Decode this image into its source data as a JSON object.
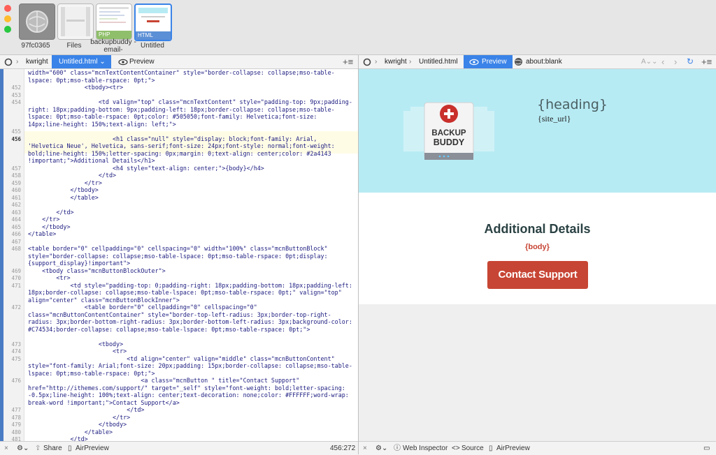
{
  "shelf": {
    "docs": [
      {
        "label": "97fc0365"
      },
      {
        "label": "Files"
      },
      {
        "label": "backupbuddy -email-",
        "tag": "PHP"
      },
      {
        "label": "Untitled",
        "tag": "HTML"
      }
    ]
  },
  "left_bar": {
    "user": "kwright",
    "tab": "Untitled.html",
    "preview_label": "Preview"
  },
  "right_bar": {
    "user": "kwright",
    "file": "Untitled.html",
    "preview_label": "Preview",
    "url": "about:blank"
  },
  "editor": {
    "lines": [
      {
        "n": "",
        "t": "width=\"600\" class=\"mcnTextContentContainer\" style=\"border-collapse: collapse;mso-table-lspace: 0pt;mso-table-rspace: 0pt;\">"
      },
      {
        "n": "452",
        "t": "                <tbody><tr>"
      },
      {
        "n": "453",
        "t": ""
      },
      {
        "n": "454",
        "t": "                    <td valign=\"top\" class=\"mcnTextContent\" style=\"padding-top: 9px;padding-right: 18px;padding-bottom: 9px;padding-left: 18px;border-collapse: collapse;mso-table-lspace: 0pt;mso-table-rspace: 0pt;color: #505050;font-family: Helvetica;font-size: 14px;line-height: 150%;text-align: left;\">"
      },
      {
        "n": "455",
        "t": ""
      },
      {
        "n": "456",
        "t": "                        <h1 class=\"null\" style=\"display: block;font-family: Arial, 'Helvetica Neue', Helvetica, sans-serif;font-size: 24px;font-style: normal;font-weight: bold;line-height: 150%;letter-spacing: 0px;margin: 0;text-align: center;color: #2a4143 !important;\">Additional Details</h1>"
      },
      {
        "n": "457",
        "t": "                        <h4 style=\"text-align: center;\">{body}</h4>"
      },
      {
        "n": "458",
        "t": "                    </td>"
      },
      {
        "n": "459",
        "t": "                </tr>"
      },
      {
        "n": "460",
        "t": "            </tbody>"
      },
      {
        "n": "461",
        "t": "            </table>"
      },
      {
        "n": "462",
        "t": ""
      },
      {
        "n": "463",
        "t": "        </td>"
      },
      {
        "n": "464",
        "t": "    </tr>"
      },
      {
        "n": "465",
        "t": "    </tbody>"
      },
      {
        "n": "466",
        "t": "</table>"
      },
      {
        "n": "467",
        "t": ""
      },
      {
        "n": "468",
        "t": "<table border=\"0\" cellpadding=\"0\" cellspacing=\"0\" width=\"100%\" class=\"mcnButtonBlock\" style=\"border-collapse: collapse;mso-table-lspace: 0pt;mso-table-rspace: 0pt;display: {support_display}!important\">"
      },
      {
        "n": "469",
        "t": "    <tbody class=\"mcnButtonBlockOuter\">"
      },
      {
        "n": "470",
        "t": "        <tr>"
      },
      {
        "n": "471",
        "t": "            <td style=\"padding-top: 0;padding-right: 18px;padding-bottom: 18px;padding-left: 18px;border-collapse: collapse;mso-table-lspace: 0pt;mso-table-rspace: 0pt;\" valign=\"top\" align=\"center\" class=\"mcnButtonBlockInner\">"
      },
      {
        "n": "472",
        "t": "                <table border=\"0\" cellpadding=\"0\" cellspacing=\"0\" class=\"mcnButtonContentContainer\" style=\"border-top-left-radius: 3px;border-top-right-radius: 3px;border-bottom-right-radius: 3px;border-bottom-left-radius: 3px;background-color: #C74534;border-collapse: collapse;mso-table-lspace: 0pt;mso-table-rspace: 0pt;\">"
      },
      {
        "n": "473",
        "t": "                    <tbody>"
      },
      {
        "n": "474",
        "t": "                        <tr>"
      },
      {
        "n": "475",
        "t": "                            <td align=\"center\" valign=\"middle\" class=\"mcnButtonContent\" style=\"font-family: Arial;font-size: 20px;padding: 15px;border-collapse: collapse;mso-table-lspace: 0pt;mso-table-rspace: 0pt;\">"
      },
      {
        "n": "476",
        "t": "                                <a class=\"mcnButton \" title=\"Contact Support\" href=\"http://ithemes.com/support/\" target=\"_self\" style=\"font-weight: bold;letter-spacing: -0.5px;line-height: 100%;text-align: center;text-decoration: none;color: #FFFFFF;word-wrap: break-word !important;\">Contact Support</a>"
      },
      {
        "n": "477",
        "t": "                            </td>"
      },
      {
        "n": "478",
        "t": "                        </tr>"
      },
      {
        "n": "479",
        "t": "                    </tbody>"
      },
      {
        "n": "480",
        "t": "                </table>"
      },
      {
        "n": "481",
        "t": "            </td>"
      },
      {
        "n": "482",
        "t": "        </tr>"
      },
      {
        "n": "483",
        "t": "    </tbody>"
      }
    ]
  },
  "preview": {
    "heading": "{heading}",
    "site_url": "{site_url}",
    "logo_line1": "BACKUP",
    "logo_line2": "BUDDY",
    "title": "Additional Details",
    "body": "{body}",
    "button": "Contact Support",
    "button_color": "#c74534",
    "title_color": "#2a4143"
  },
  "bottom_left": {
    "share": "Share",
    "airpreview": "AirPreview",
    "position": "456:272"
  },
  "bottom_right": {
    "inspector": "Web Inspector",
    "source": "Source",
    "airpreview": "AirPreview"
  }
}
